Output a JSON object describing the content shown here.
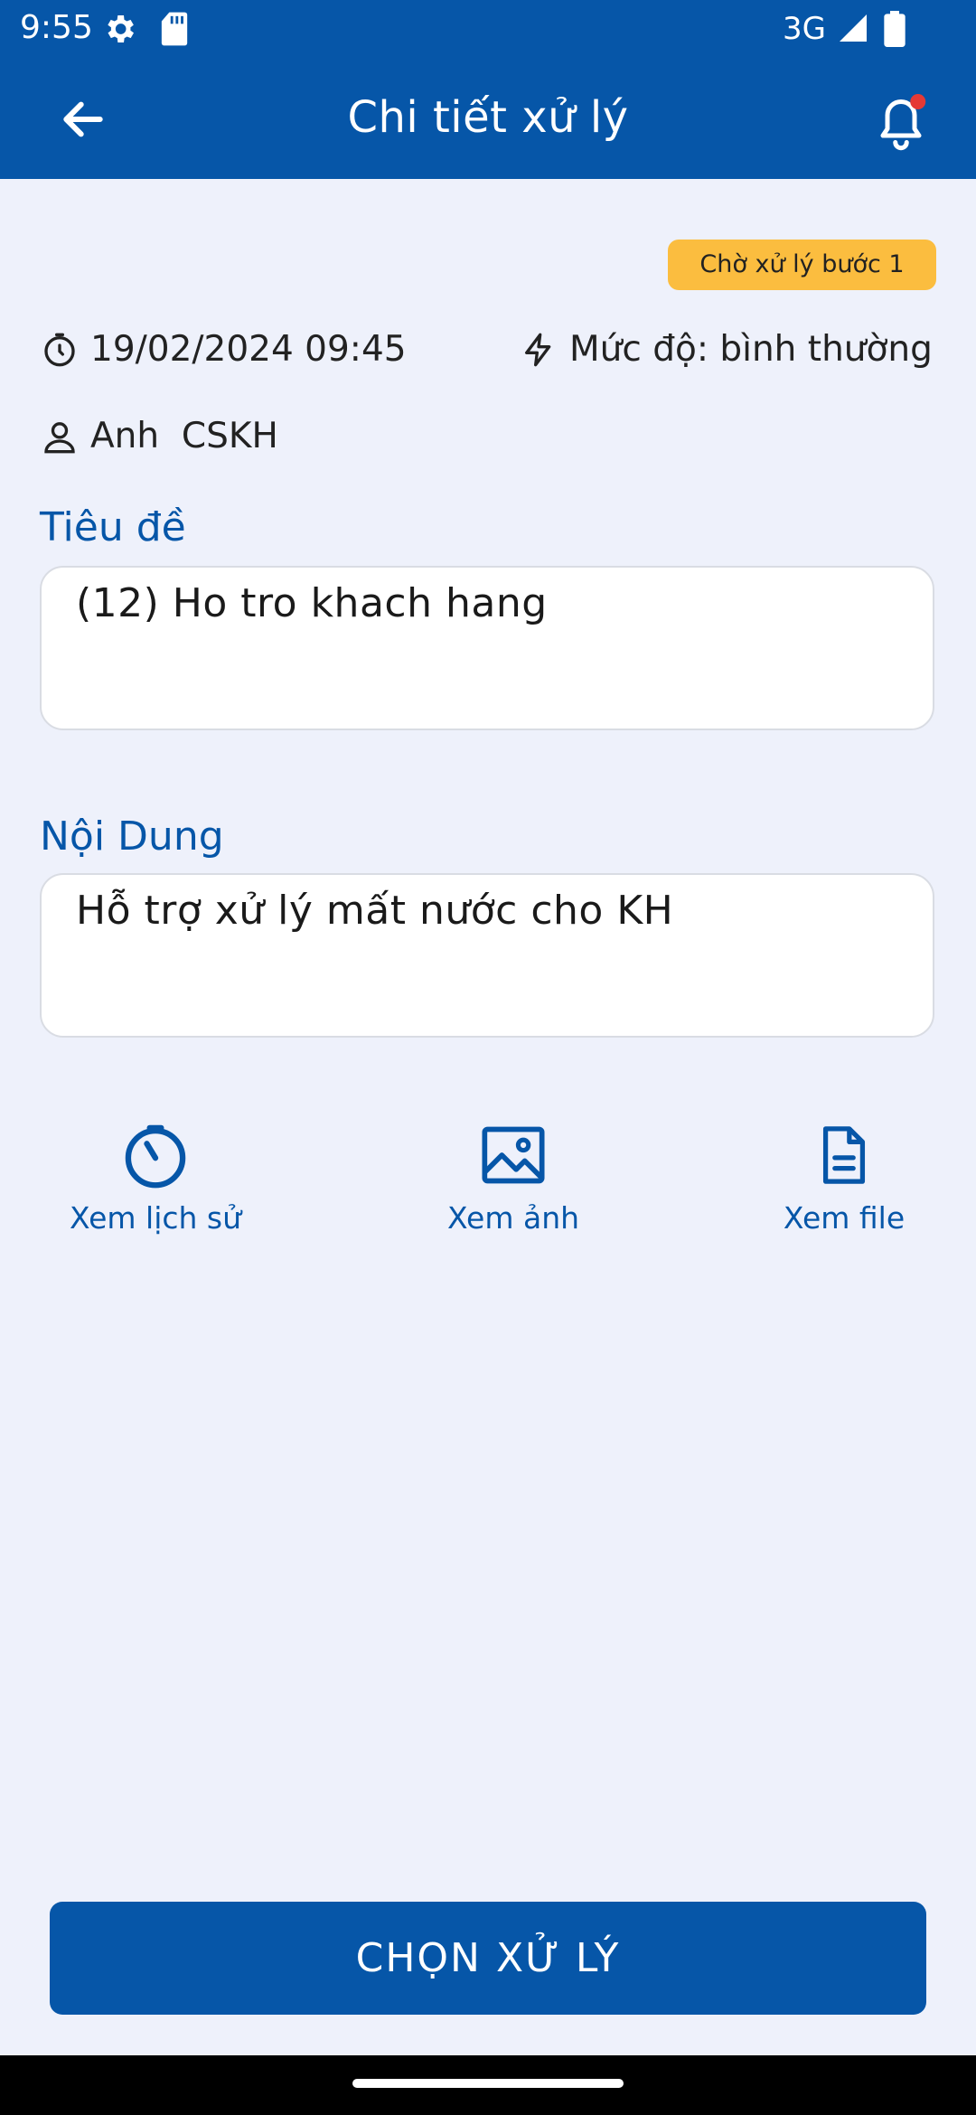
{
  "status_bar": {
    "time": "9:55",
    "network": "3G",
    "icons": [
      "settings-icon",
      "sd-card-icon",
      "signal-icon",
      "battery-icon"
    ]
  },
  "app_bar": {
    "title": "Chi tiết xử lý",
    "back_icon": "arrow-left-icon",
    "notification_icon": "bell-icon",
    "has_unread_dot": true
  },
  "ticket": {
    "status_badge": "Chờ xử lý bước 1",
    "datetime": "19/02/2024 09:45",
    "priority": "Mức độ: bình thường",
    "user": "Anh  CSKH",
    "title_label": "Tiêu đề",
    "title_value": "(12) Ho tro khach hang",
    "content_label": "Nội Dung",
    "content_value": "Hỗ trợ xử lý mất nước cho KH"
  },
  "actions": [
    {
      "label": "Xem lịch sử",
      "icon": "history-timer-icon"
    },
    {
      "label": "Xem ảnh",
      "icon": "image-icon"
    },
    {
      "label": "Xem file",
      "icon": "file-icon"
    }
  ],
  "primary_button": "CHỌN XỬ LÝ",
  "colors": {
    "primary": "#0656a8",
    "background": "#eef1fb",
    "badge": "#fbbd3f",
    "notification_dot": "#e53935"
  }
}
